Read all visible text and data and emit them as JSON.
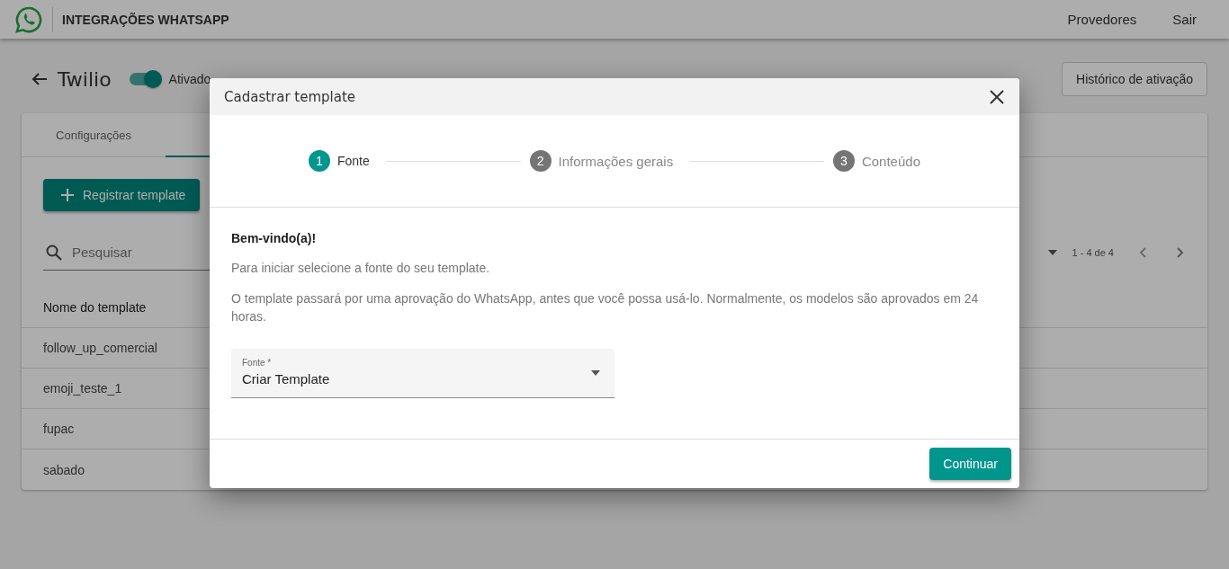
{
  "header": {
    "title": "INTEGRAÇÕES WHATSAPP",
    "nav": [
      "Provedores",
      "Sair"
    ]
  },
  "page": {
    "title": "Twilio",
    "toggle": {
      "label": "Ativado",
      "on": true
    },
    "history_button": "Histórico de ativação"
  },
  "tabs": [
    {
      "label": "Configurações",
      "selected": false
    },
    {
      "selected": true
    }
  ],
  "register_button": "Registrar template",
  "search": {
    "placeholder": "Pesquisar"
  },
  "paginator": {
    "range": "1 - 4 de 4"
  },
  "table": {
    "columns": [
      "Nome do template"
    ],
    "rows": [
      [
        "follow_up_comercial"
      ],
      [
        "emoji_teste_1"
      ],
      [
        "fupac"
      ],
      [
        "sabado"
      ]
    ]
  },
  "dialog": {
    "title": "Cadastrar template",
    "steps": [
      {
        "number": "1",
        "label": "Fonte",
        "selected": true
      },
      {
        "number": "2",
        "label": "Informações gerais",
        "selected": false
      },
      {
        "number": "3",
        "label": "Conteúdo",
        "selected": false
      }
    ],
    "heading": "Bem-vindo(a)!",
    "paragraphs": [
      "Para iniciar selecione a fonte do seu template.",
      "O template passará por uma aprovação do WhatsApp, antes que você possa usá-lo. Normalmente, os modelos são aprovados em 24 horas."
    ],
    "select": {
      "label": "Fonte *",
      "value": "Criar Template"
    },
    "continue_button": "Continuar"
  }
}
